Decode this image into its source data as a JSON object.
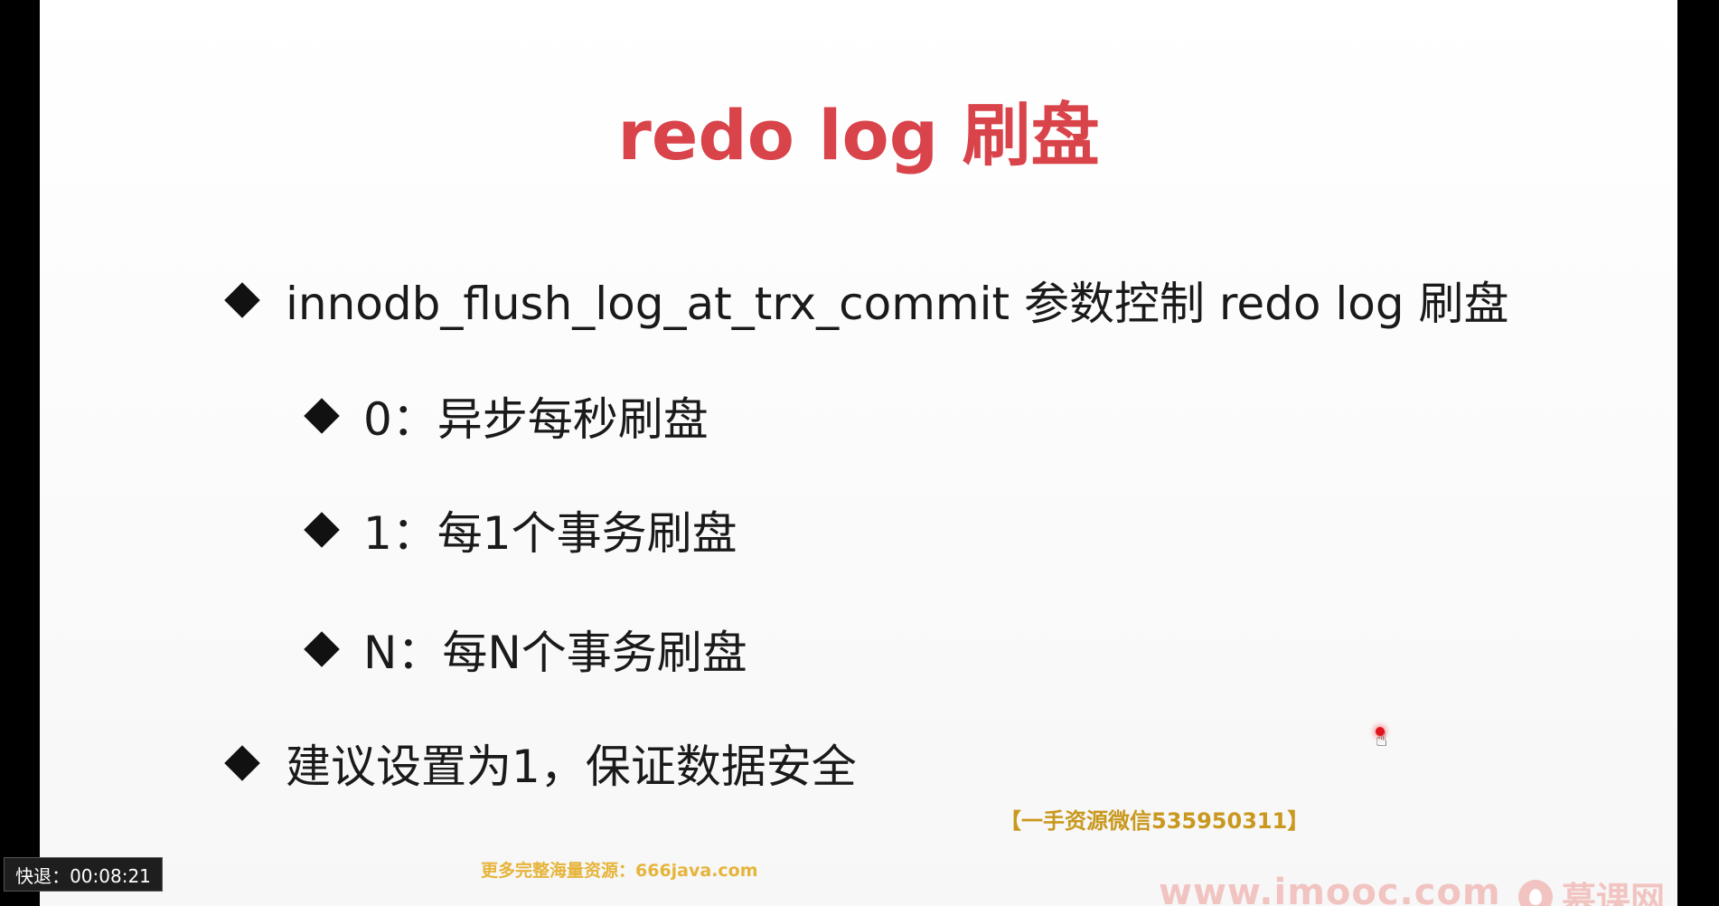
{
  "slide": {
    "title": "redo log 刷盘",
    "bullets": [
      "innodb_flush_log_at_trx_commit 参数控制 redo log 刷盘",
      "0：异步每秒刷盘",
      "1：每1个事务刷盘",
      "N：每N个事务刷盘",
      "建议设置为1，保证数据安全"
    ]
  },
  "watermarks": {
    "wechat": "【一手资源微信535950311】",
    "java": "更多完整海量资源：666java.com",
    "site": "www.imooc.com",
    "brand": "慕课网"
  },
  "player": {
    "rewind_label": "快退：00:08:21"
  },
  "colors": {
    "title": "#d9434a",
    "text": "#1a1a1a",
    "watermark": "#f1c4c1"
  }
}
